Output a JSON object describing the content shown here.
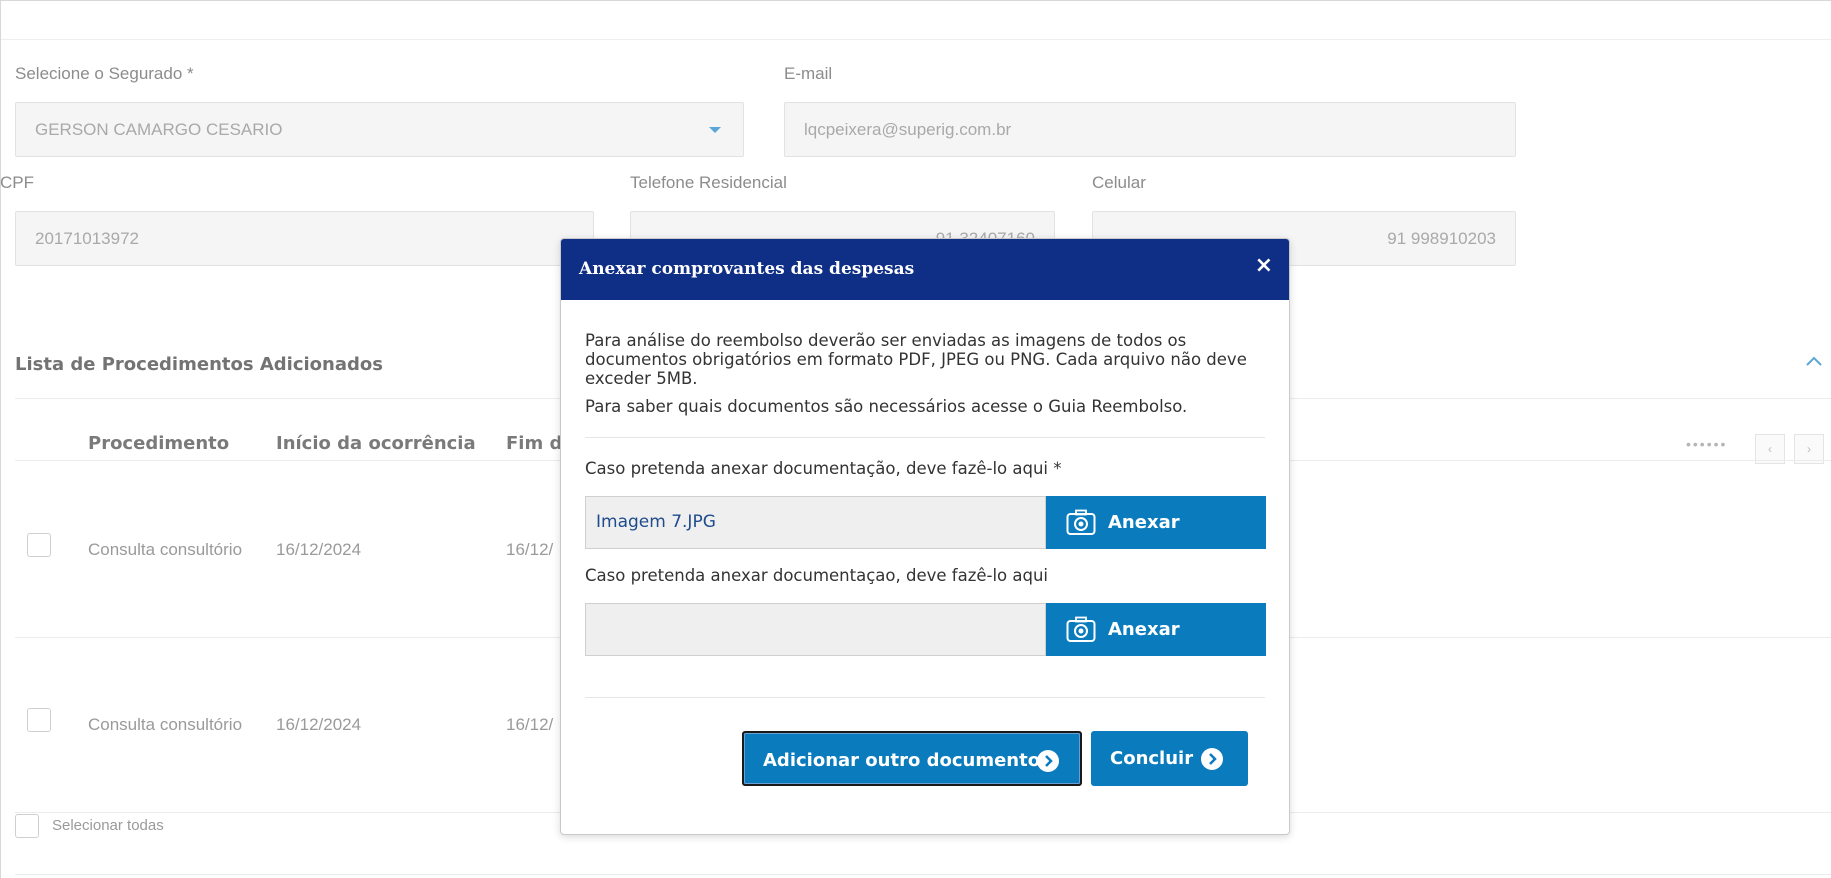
{
  "form": {
    "segurado_label": "Selecione o Segurado *",
    "segurado_value": "GERSON CAMARGO CESARIO",
    "email_label": "E-mail",
    "email_value": "lqcpeixera@superig.com.br",
    "cpf_label": "CPF",
    "cpf_value": "20171013972",
    "telefone_label": "Telefone Residencial",
    "telefone_value": "91 32407160",
    "celular_label": "Celular",
    "celular_value": "91 998910203"
  },
  "list": {
    "title": "Lista de Procedimentos Adicionados",
    "columns": [
      "Procedimento",
      "Início da ocorrência",
      "Fim d"
    ],
    "rows": [
      {
        "procedimento": "Consulta consultório",
        "inicio": "16/12/2024",
        "fim": "16/12/"
      },
      {
        "procedimento": "Consulta consultório",
        "inicio": "16/12/2024",
        "fim": "16/12/"
      }
    ],
    "select_all": "Selecionar todas",
    "pager_dots": "••••••"
  },
  "modal": {
    "title": "Anexar comprovantes das despesas",
    "close": "×",
    "intro": "Para análise do reembolso deverão ser enviadas as imagens de todos os documentos obrigatórios em formato PDF, JPEG ou PNG. Cada arquivo não deve exceder 5MB.",
    "guide": "Para saber quais documentos são necessários acesse o Guia Reembolso.",
    "attach1_label": "Caso pretenda anexar documentação, deve fazê-lo aqui *",
    "attach1_file": "Imagem 7.JPG",
    "attach2_label": "Caso pretenda anexar documentaçao, deve fazê-lo aqui",
    "attach2_file": "",
    "attach_button": "Anexar",
    "add_doc_button": "Adicionar outro documento",
    "finish_button": "Concluir"
  },
  "colors": {
    "modal_header": "#0f2e85",
    "button": "#0a7bbd"
  }
}
